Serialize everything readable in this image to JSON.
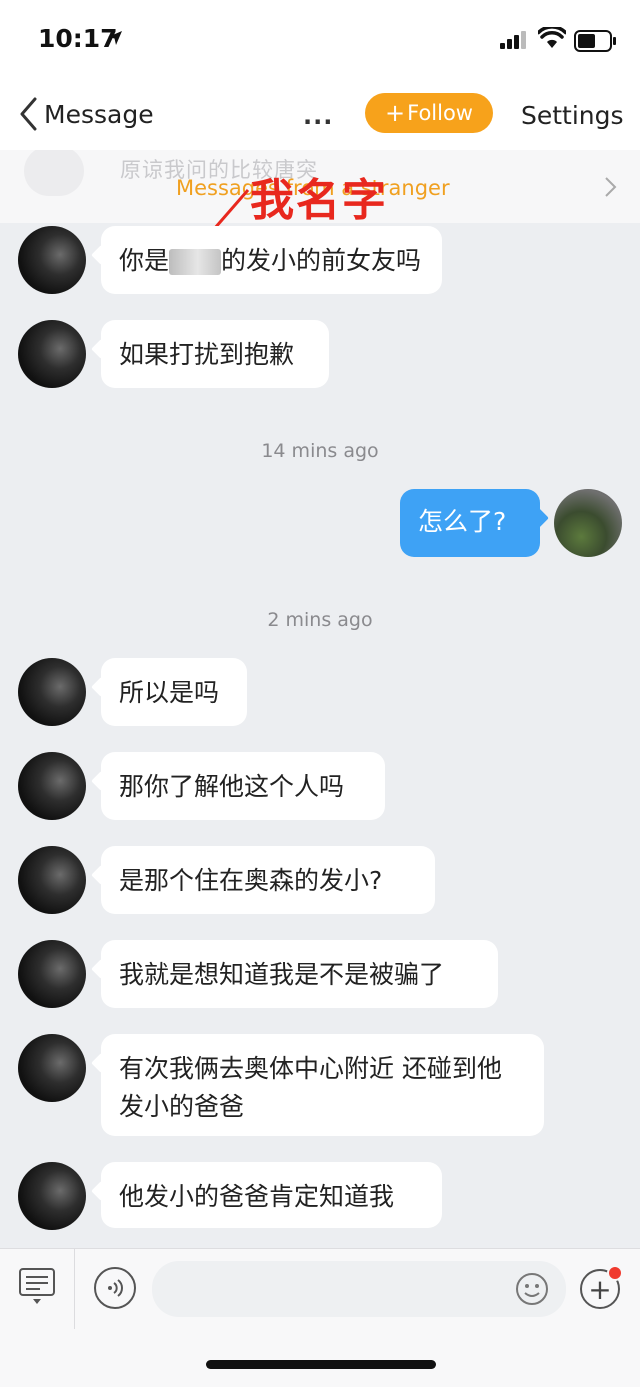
{
  "status_bar": {
    "time": "10:17"
  },
  "nav": {
    "back_label": "Message",
    "more_label": "...",
    "follow_label": "Follow",
    "settings_label": "Settings"
  },
  "stranger_banner": {
    "text": "Messages from a stranger",
    "ghost_text": "原谅我问的比较唐突"
  },
  "annotation": {
    "text": "我名字"
  },
  "messages": [
    {
      "side": "in",
      "parts": [
        "你是",
        "[redacted]",
        "的发小的前女友吗"
      ]
    },
    {
      "side": "in",
      "text": "如果打扰到抱歉"
    },
    {
      "type": "timestamp",
      "text": "14 mins ago"
    },
    {
      "side": "out",
      "text": "怎么了?"
    },
    {
      "type": "timestamp",
      "text": "2 mins ago"
    },
    {
      "side": "in",
      "text": "所以是吗"
    },
    {
      "side": "in",
      "text": "那你了解他这个人吗"
    },
    {
      "side": "in",
      "text": "是那个住在奥森的发小?"
    },
    {
      "side": "in",
      "text": "我就是想知道我是不是被骗了"
    },
    {
      "side": "in",
      "text": "有次我俩去奥体中心附近 还碰到他发小的爸爸"
    },
    {
      "side": "in",
      "text": "他发小的爸爸肯定知道我"
    }
  ],
  "bottom_bar": {
    "icons": [
      "keyboard-menu-icon",
      "voice-icon",
      "emoji-icon",
      "plus-icon"
    ],
    "input_value": ""
  },
  "colors": {
    "accent": "#f7a21b",
    "outgoing_bubble": "#3ea2f5",
    "stranger_text": "#f0a020",
    "annotation": "#e8281e",
    "background": "#eceef1"
  }
}
